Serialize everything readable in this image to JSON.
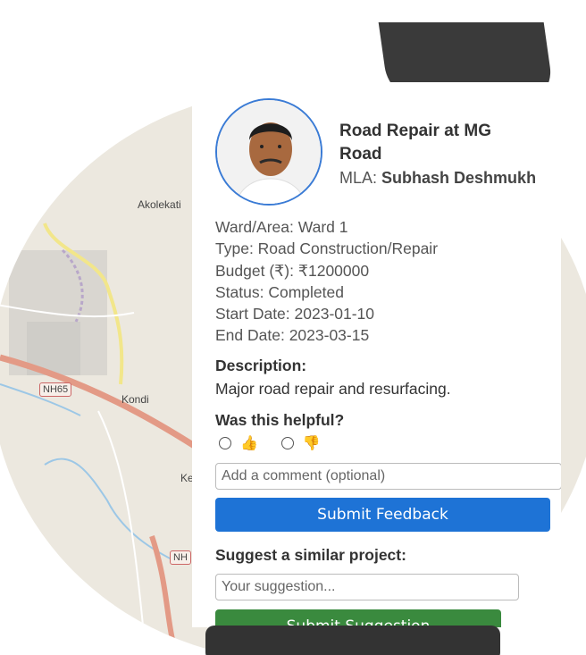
{
  "map": {
    "labels": [
      "Akolekati",
      "Kondi",
      "Ke"
    ],
    "highway_shields": [
      "NH65",
      "NH"
    ]
  },
  "project": {
    "title": "Road Repair at MG Road",
    "mla_label": "MLA:",
    "mla_name": "Subhash Deshmukh",
    "details": [
      "Ward/Area: Ward 1",
      "Type: Road Construction/Repair",
      "Budget (₹): ₹1200000",
      "Status: Completed",
      "Start Date: 2023-01-10",
      "End Date: 2023-03-15"
    ],
    "description_heading": "Description:",
    "description": "Major road repair and resurfacing."
  },
  "feedback": {
    "heading": "Was this helpful?",
    "option_up": "👍",
    "option_down": "👎",
    "comment_placeholder": "Add a comment (optional)",
    "submit_label": "Submit Feedback"
  },
  "suggestion": {
    "heading": "Suggest a similar project:",
    "placeholder": "Your suggestion...",
    "submit_label": "Submit Suggestion"
  },
  "colors": {
    "primary_button": "#1e73d6",
    "success_button": "#3a8a3e",
    "avatar_ring": "#3a7bd5"
  }
}
